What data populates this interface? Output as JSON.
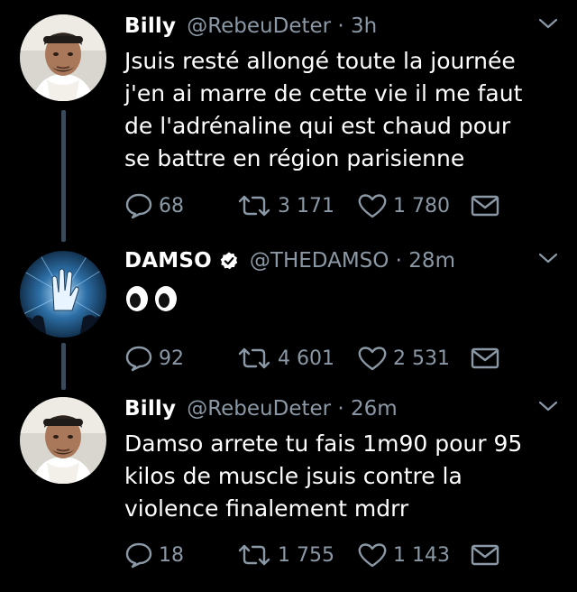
{
  "colors": {
    "background": "#000000",
    "text": "#ffffff",
    "secondary": "#8b98a5",
    "thread_line": "#3b4a5a",
    "verified": "#ffffff"
  },
  "tweets": [
    {
      "name": "Billy",
      "handle": "@RebeuDeter · 3h",
      "verified": false,
      "text_lines": [
        "Jsuis resté allongé toute la journée",
        "j'en ai marre de cette vie il me faut",
        "de l'adrénaline qui est chaud pour",
        "se battre en région parisienne"
      ],
      "replies": "68",
      "retweets": "3 171",
      "likes": "1 780",
      "avatar_icon": "user-avatar-billy"
    },
    {
      "name": "DAMSO",
      "handle": "@THEDAMSO · 28m",
      "verified": true,
      "text_lines": [
        "👀"
      ],
      "replies": "92",
      "retweets": "4 601",
      "likes": "2 531",
      "avatar_icon": "user-avatar-damso"
    },
    {
      "name": "Billy",
      "handle": "@RebeuDeter · 26m",
      "verified": false,
      "text_lines": [
        "Damso arrete tu fais 1m90 pour 95",
        "kilos de muscle jsuis contre la",
        "violence finalement mdrr"
      ],
      "replies": "18",
      "retweets": "1 755",
      "likes": "1 143",
      "avatar_icon": "user-avatar-billy"
    }
  ]
}
